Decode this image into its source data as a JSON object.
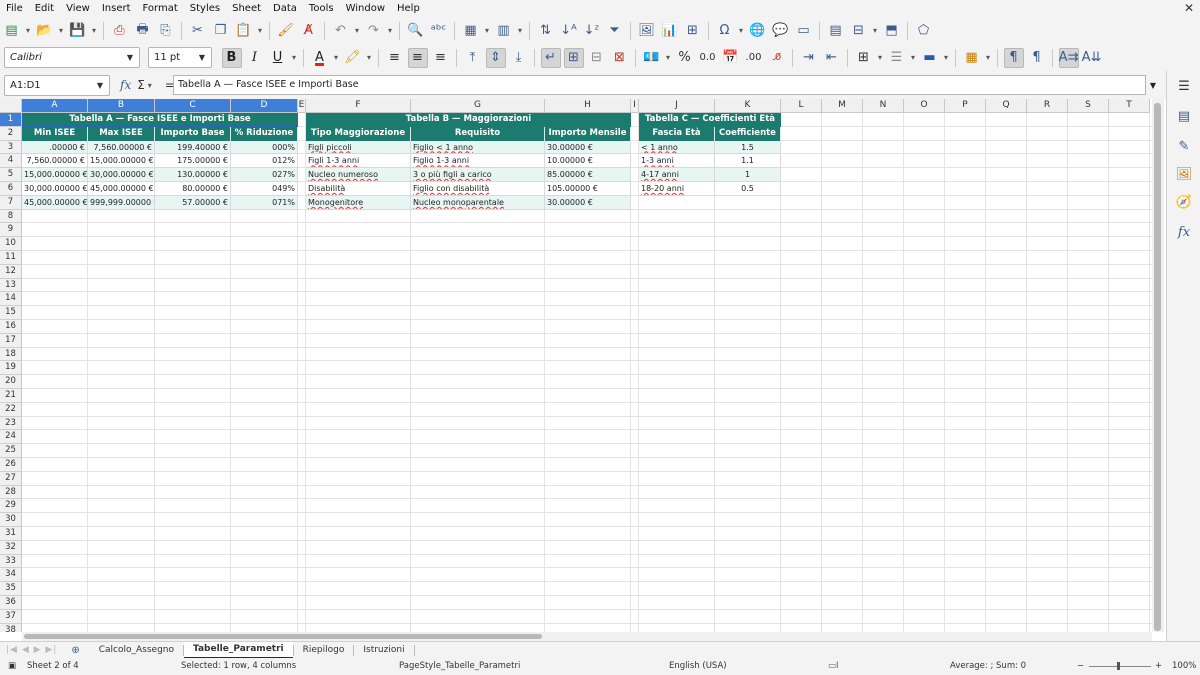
{
  "menu": [
    "File",
    "Edit",
    "View",
    "Insert",
    "Format",
    "Styles",
    "Sheet",
    "Data",
    "Tools",
    "Window",
    "Help"
  ],
  "toolbar": {
    "font_name": "Calibri",
    "font_size": "11 pt"
  },
  "formula_bar": {
    "name_box": "A1:D1",
    "content": "Tabella A — Fasce ISEE e Importi Base"
  },
  "columns": [
    "A",
    "B",
    "C",
    "D",
    "E",
    "F",
    "G",
    "H",
    "I",
    "J",
    "K",
    "L",
    "M",
    "N",
    "O",
    "P",
    "Q",
    "R",
    "S",
    "T"
  ],
  "rows": [
    "1",
    "2",
    "3",
    "4",
    "5",
    "6",
    "7",
    "8",
    "9",
    "10",
    "11",
    "12",
    "13",
    "14",
    "15",
    "16",
    "17",
    "18",
    "19",
    "20",
    "21",
    "22",
    "23",
    "24",
    "25",
    "26",
    "27",
    "28",
    "29",
    "30",
    "31",
    "32",
    "33",
    "34",
    "35",
    "36",
    "37",
    "38"
  ],
  "table_a": {
    "title": "Tabella A — Fasce ISEE e Importi Base",
    "headers": [
      "Min ISEE",
      "Max ISEE",
      "Importo Base",
      "% Riduzione"
    ],
    "rows": [
      [
        ".00000 €",
        "7,560.00000 €",
        "199.40000 €",
        "000%"
      ],
      [
        "7,560.00000 €",
        "15,000.00000 €",
        "175.00000 €",
        "012%"
      ],
      [
        "15,000.00000 €",
        "30,000.00000 €",
        "130.00000 €",
        "027%"
      ],
      [
        "30,000.00000 €",
        "45,000.00000 €",
        "80.00000 €",
        "049%"
      ],
      [
        "45,000.00000 €",
        "999,999.00000 €",
        "57.00000 €",
        "071%"
      ]
    ]
  },
  "table_b": {
    "title": "Tabella B — Maggiorazioni",
    "headers": [
      "Tipo Maggiorazione",
      "Requisito",
      "Importo Mensile"
    ],
    "rows": [
      [
        "Figli piccoli",
        "Figlio < 1 anno",
        "30.00000 €"
      ],
      [
        "Figli 1-3 anni",
        "Figlio 1-3 anni",
        "10.00000 €"
      ],
      [
        "Nucleo numeroso",
        "3 o più figli a carico",
        "85.00000 €"
      ],
      [
        "Disabilità",
        "Figlio con disabilità",
        "105.00000 €"
      ],
      [
        "Monogenitore",
        "Nucleo monoparentale",
        "30.00000 €"
      ]
    ]
  },
  "table_c": {
    "title": "Tabella C — Coefficienti Età",
    "headers": [
      "Fascia Età",
      "Coefficiente"
    ],
    "rows": [
      [
        "< 1 anno",
        "1.5"
      ],
      [
        "1-3 anni",
        "1.1"
      ],
      [
        "4-17 anni",
        "1"
      ],
      [
        "18-20 anni",
        "0.5"
      ]
    ]
  },
  "sheet_tabs": [
    "Calcolo_Assegno",
    "Tabelle_Parametri",
    "Riepilogo",
    "Istruzioni"
  ],
  "active_tab": "Tabelle_Parametri",
  "status": {
    "sheet": "Sheet 2 of 4",
    "selection": "Selected: 1 row, 4 columns",
    "page_style": "PageStyle_Tabelle_Parametri",
    "language": "English (USA)",
    "sum": "Average: ; Sum: 0",
    "zoom": "100%"
  },
  "colors": {
    "table_header": "#1a7b6e",
    "alt_row": "#e8f6f3",
    "selection": "#3f7fd8"
  }
}
